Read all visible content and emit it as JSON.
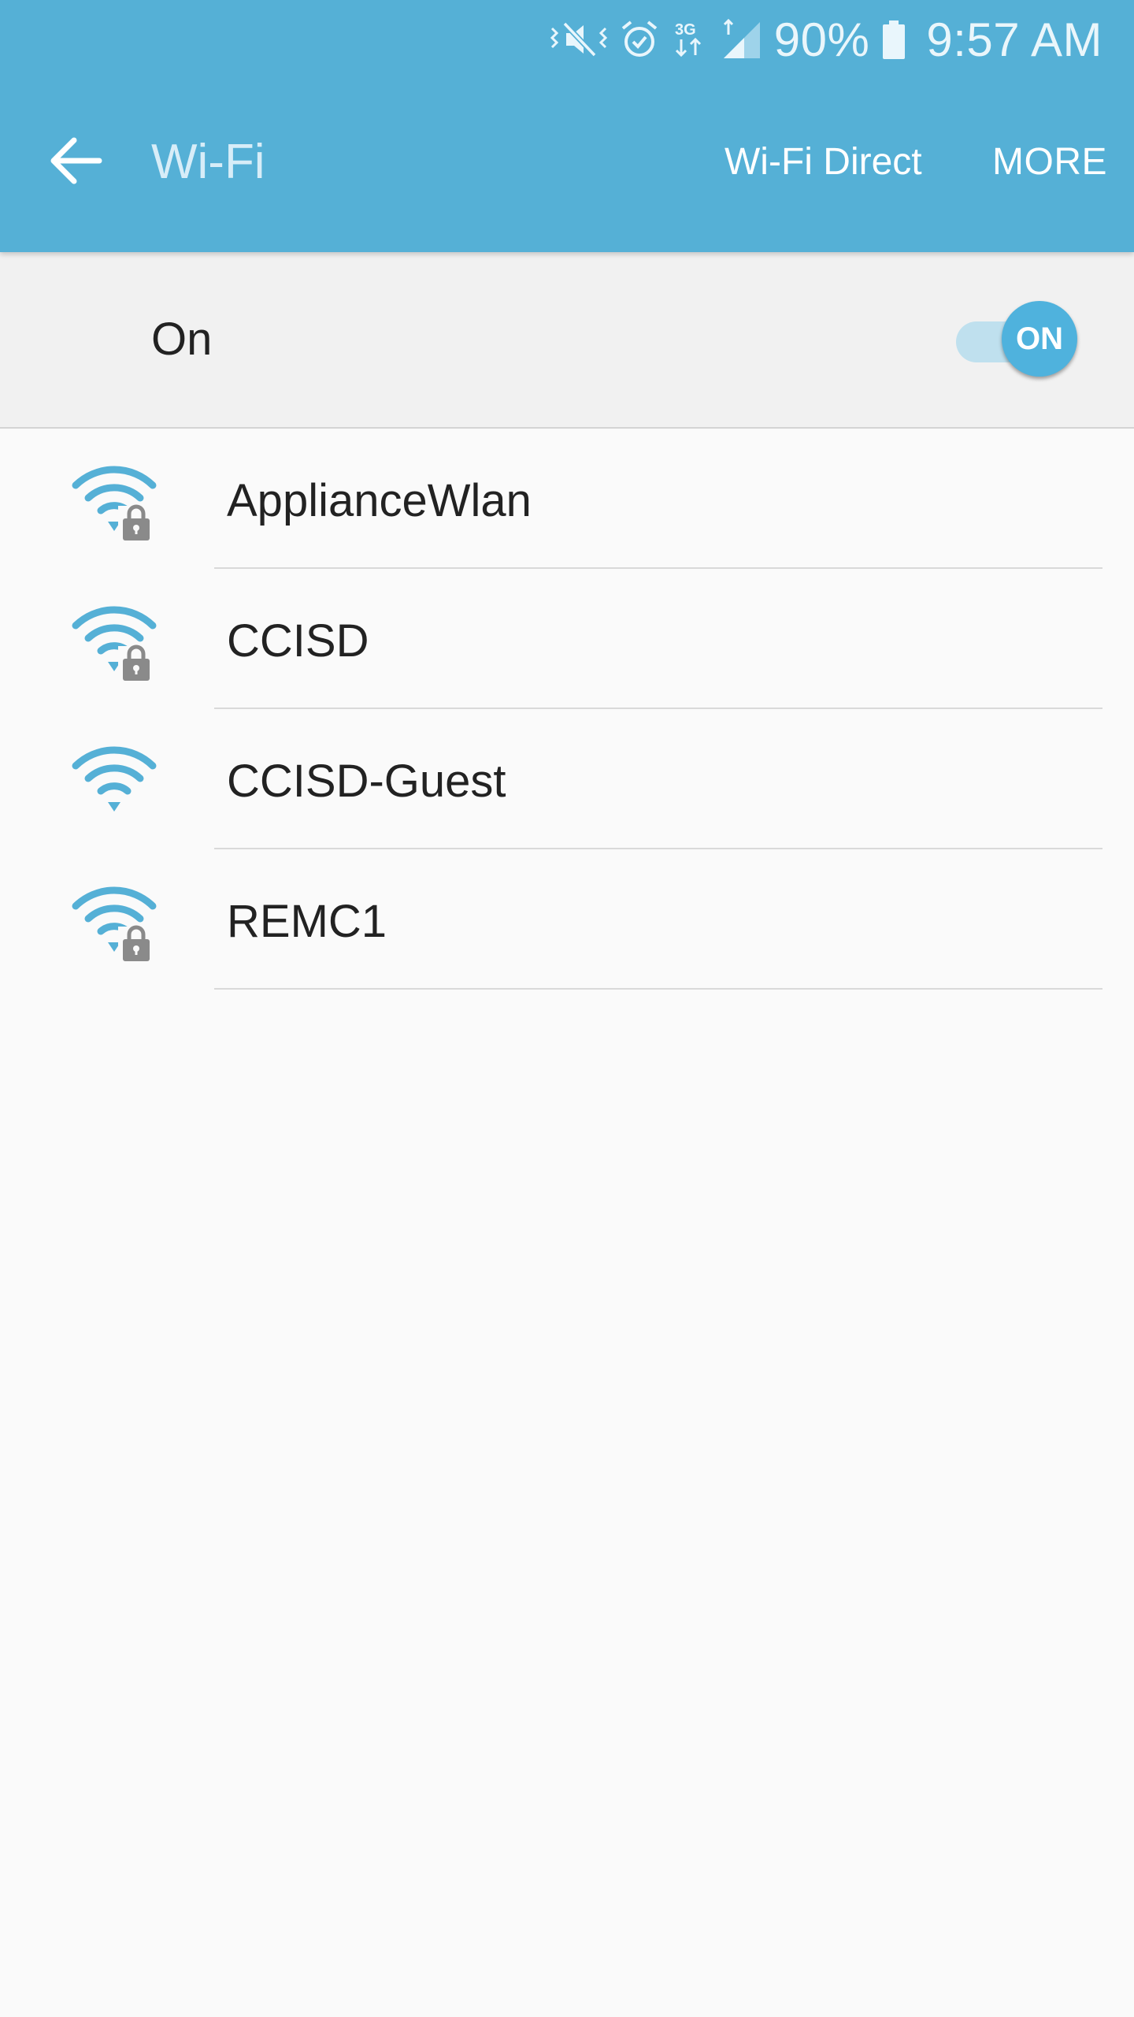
{
  "status_bar": {
    "network_type": "3G",
    "battery": "90%",
    "time": "9:57 AM",
    "icons": [
      "vibrate-mute-icon",
      "alarm-icon",
      "3g-data-icon",
      "signal-icon",
      "battery-icon"
    ]
  },
  "app_bar": {
    "title": "Wi-Fi",
    "actions": {
      "wifi_direct": "Wi-Fi Direct",
      "more": "MORE"
    },
    "colors": {
      "background": "#55b0d6",
      "title": "#d7edf8"
    }
  },
  "master_switch": {
    "label": "On",
    "toggle_text": "ON",
    "state": true,
    "accent": "#4fb2dd"
  },
  "networks": [
    {
      "name": "ApplianceWlan",
      "secured": true
    },
    {
      "name": "CCISD",
      "secured": true
    },
    {
      "name": "CCISD-Guest",
      "secured": false
    },
    {
      "name": "REMC1",
      "secured": true
    }
  ]
}
